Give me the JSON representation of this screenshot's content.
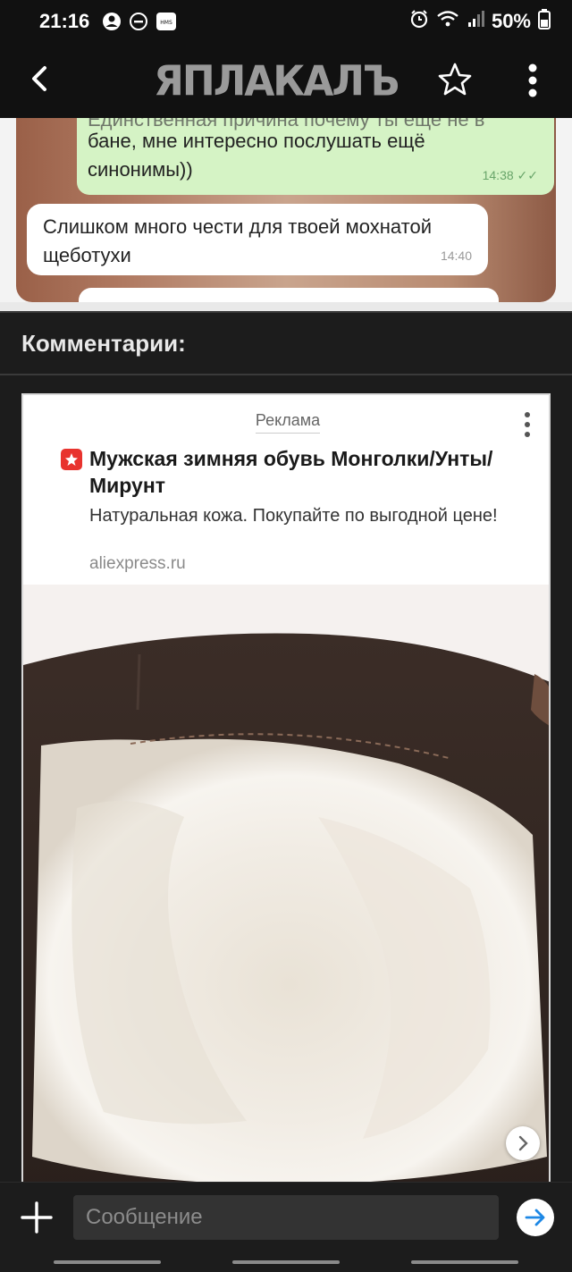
{
  "status_bar": {
    "time": "21:16",
    "hms_label": "HMS",
    "battery": "50%",
    "icons": [
      "person-icon",
      "dnd-icon",
      "hms-icon",
      "alarm-icon",
      "wifi-icon",
      "signal-icon",
      "battery-icon"
    ]
  },
  "app_bar": {
    "logo": "ЯПЛАКАЛЪ",
    "back_icon": "chevron-left-icon",
    "favorite_icon": "star-outline-icon",
    "menu_icon": "more-vert-icon"
  },
  "chat": {
    "green_bubble_cut": "Единственная причина почему ты еще не в",
    "green_bubble_text": "бане, мне интересно послушать ещё синонимы))",
    "green_bubble_time": "14:38 ✓✓",
    "white_bubble_text": "Слишком много чести для твоей мохнатой щеботухи",
    "white_bubble_time": "14:40"
  },
  "comments": {
    "heading": "Комментарии:"
  },
  "ad": {
    "label": "Реклама",
    "title": "Мужская зимняя обувь Монголки/Унты/Мирунт",
    "description": "Натуральная кожа. Покупайте по выгодной цене!",
    "domain": "aliexpress.ru",
    "next_icon": "chevron-right-icon"
  },
  "composer": {
    "placeholder": "Сообщение",
    "add_icon": "plus-icon",
    "send_icon": "arrow-right-icon"
  },
  "colors": {
    "background": "#1c1c1c",
    "bar": "#111111",
    "ad_logo": "#e8332e",
    "send_arrow": "#1e88e5",
    "green_bubble": "#d5f3c5"
  }
}
